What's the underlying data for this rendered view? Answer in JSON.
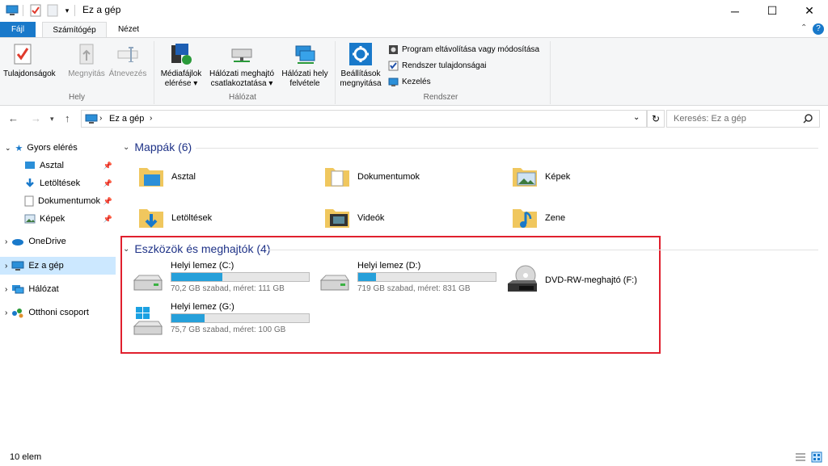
{
  "window": {
    "title": "Ez a gép"
  },
  "tabs": {
    "file": "Fájl",
    "computer": "Számítógép",
    "view": "Nézet"
  },
  "ribbon": {
    "properties": "Tulajdonságok",
    "open": "Megnyitás",
    "rename": "Átnevezés",
    "group_help": "Hely",
    "media_line1": "Médiafájlok",
    "media_line2": "elérése ▾",
    "netdrive_line1": "Hálózati meghajtó",
    "netdrive_line2": "csatlakoztatása ▾",
    "netloc_line1": "Hálózati hely",
    "netloc_line2": "felvétele",
    "group_network": "Hálózat",
    "settings_line1": "Beállítások",
    "settings_line2": "megnyitása",
    "uninstall": "Program eltávolítása vagy módosítása",
    "sysprops": "Rendszer tulajdonságai",
    "manage": "Kezelés",
    "group_system": "Rendszer"
  },
  "nav": {
    "path": "Ez a gép",
    "search_placeholder": "Keresés: Ez a gép"
  },
  "sidebar": {
    "quick": "Gyors elérés",
    "desktop": "Asztal",
    "downloads": "Letöltések",
    "documents": "Dokumentumok",
    "pictures": "Képek",
    "onedrive": "OneDrive",
    "thispc": "Ez a gép",
    "network": "Hálózat",
    "homegroup": "Otthoni csoport"
  },
  "folders_section": "Mappák (6)",
  "folders": [
    "Asztal",
    "Dokumentumok",
    "Képek",
    "Letöltések",
    "Videók",
    "Zene"
  ],
  "devices_section": "Eszközök és meghajtók (4)",
  "drives": [
    {
      "name": "Helyi lemez (C:)",
      "free": "70,2 GB szabad, méret: 111 GB",
      "used_pct": 37
    },
    {
      "name": "Helyi lemez (D:)",
      "free": "719 GB szabad, méret: 831 GB",
      "used_pct": 13
    },
    {
      "name": "DVD-RW-meghajtó (F:)"
    },
    {
      "name": "Helyi lemez (G:)",
      "free": "75,7 GB szabad, méret: 100 GB",
      "used_pct": 24
    }
  ],
  "status": {
    "count": "10 elem"
  },
  "colors": {
    "accent": "#1979ca",
    "progress": "#26a0da",
    "highlight": "#e0202e",
    "section": "#1e3287"
  }
}
